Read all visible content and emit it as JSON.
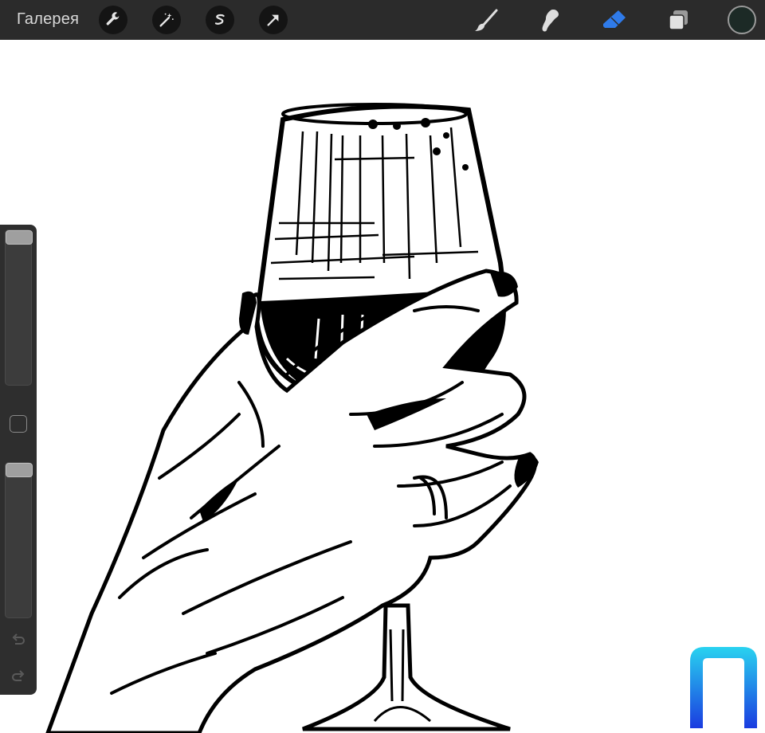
{
  "toolbar": {
    "gallery_label": "Галерея",
    "left_tools": [
      {
        "name": "actions-wrench-icon"
      },
      {
        "name": "adjustments-magic-wand-icon"
      },
      {
        "name": "selection-s-icon"
      },
      {
        "name": "transform-arrow-icon"
      }
    ],
    "right_tools": [
      {
        "name": "brush-icon",
        "active": false
      },
      {
        "name": "smudge-icon",
        "active": false
      },
      {
        "name": "eraser-icon",
        "active": true
      },
      {
        "name": "layers-icon",
        "active": false
      }
    ],
    "current_color": "#1c2a26"
  },
  "sidebar": {
    "brush_size": 0.0,
    "brush_opacity": 0.0,
    "modify_button": "square-modify-icon",
    "undo": "undo-arrow-icon",
    "redo": "redo-arrow-icon"
  },
  "canvas": {
    "artwork": "ink-drawing-hand-holding-wine-glass"
  },
  "colors": {
    "toolbar_bg": "#2b2b2b",
    "active_tool": "#2f7bea",
    "canvas": "#ffffff"
  }
}
